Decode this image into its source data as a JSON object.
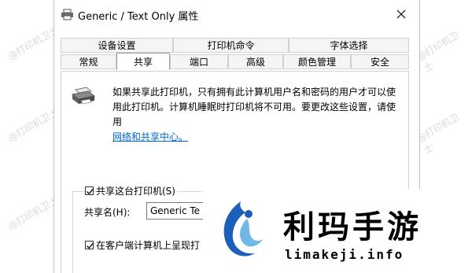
{
  "window": {
    "title": "Generic / Text Only 属性",
    "close_glyph": "✕"
  },
  "tabs": {
    "row1": [
      "设备设置",
      "打印机命令",
      "字体选择"
    ],
    "row2": [
      "常规",
      "共享",
      "端口",
      "高级",
      "颜色管理",
      "安全"
    ],
    "active": "共享"
  },
  "sharing": {
    "description_line1": "如果共享此打印机，只有拥有此计算机用户名和密码的用户才可以使",
    "description_line2": "用此打印机。计算机睡眠时打印机将不可用。要更改这些设置，请使用",
    "description_link": "网络和共享中心。",
    "share_checkbox_label": "共享这台打印机(S)",
    "share_checked": true,
    "share_name_label": "共享名(H):",
    "share_name_value": "Generic  Te",
    "render_checkbox_label": "在客户端计算机上呈现打",
    "render_checked": true
  },
  "watermark": {
    "text": "@打印机卫士"
  },
  "overlay": {
    "brand_name": "利玛手游",
    "brand_url": "limakeji.info",
    "logo_colors": [
      "#1c5fb8",
      "#6fb8e8"
    ]
  },
  "icons": [
    "printer-icon",
    "close-icon",
    "checkbox-check-icon",
    "brand-logo-icon"
  ]
}
